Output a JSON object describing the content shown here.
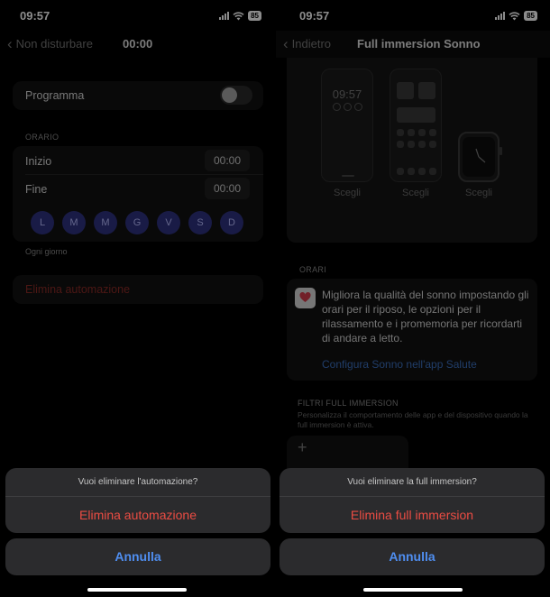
{
  "status": {
    "time": "09:57",
    "battery": "85"
  },
  "left": {
    "nav": {
      "back_label": "Non disturbare",
      "title": "00:00"
    },
    "programma_label": "Programma",
    "orario": {
      "header": "ORARIO",
      "start_label": "Inizio",
      "start_value": "00:00",
      "end_label": "Fine",
      "end_value": "00:00",
      "days": [
        "L",
        "M",
        "M",
        "G",
        "V",
        "S",
        "D"
      ],
      "footnote": "Ogni giorno"
    },
    "delete_row_label": "Elimina automazione",
    "sheet": {
      "question": "Vuoi eliminare l'automazione?",
      "action": "Elimina automazione",
      "cancel": "Annulla"
    }
  },
  "right": {
    "nav": {
      "back_label": "Indietro",
      "title": "Full immersion Sonno"
    },
    "lock_time": "09:57",
    "choose_labels": [
      "Scegli",
      "Scegli",
      "Scegli"
    ],
    "orari": {
      "header": "ORARI",
      "text": "Migliora la qualità del sonno impostando gli orari per il riposo, le opzioni per il rilassamento e i promemoria per ricordarti di andare a letto.",
      "link": "Configura Sonno nell'app Salute"
    },
    "filters": {
      "header": "FILTRI FULL IMMERSION",
      "description": "Personalizza il comportamento delle app e del dispositivo quando la full immersion è attiva.",
      "add_symbol": "+"
    },
    "sheet": {
      "question": "Vuoi eliminare la full immersion?",
      "action": "Elimina full immersion",
      "cancel": "Annulla"
    }
  },
  "colors": {
    "destructive": "#eb4c43",
    "link": "#4f8ef0",
    "day_circle": "#2e3280"
  }
}
